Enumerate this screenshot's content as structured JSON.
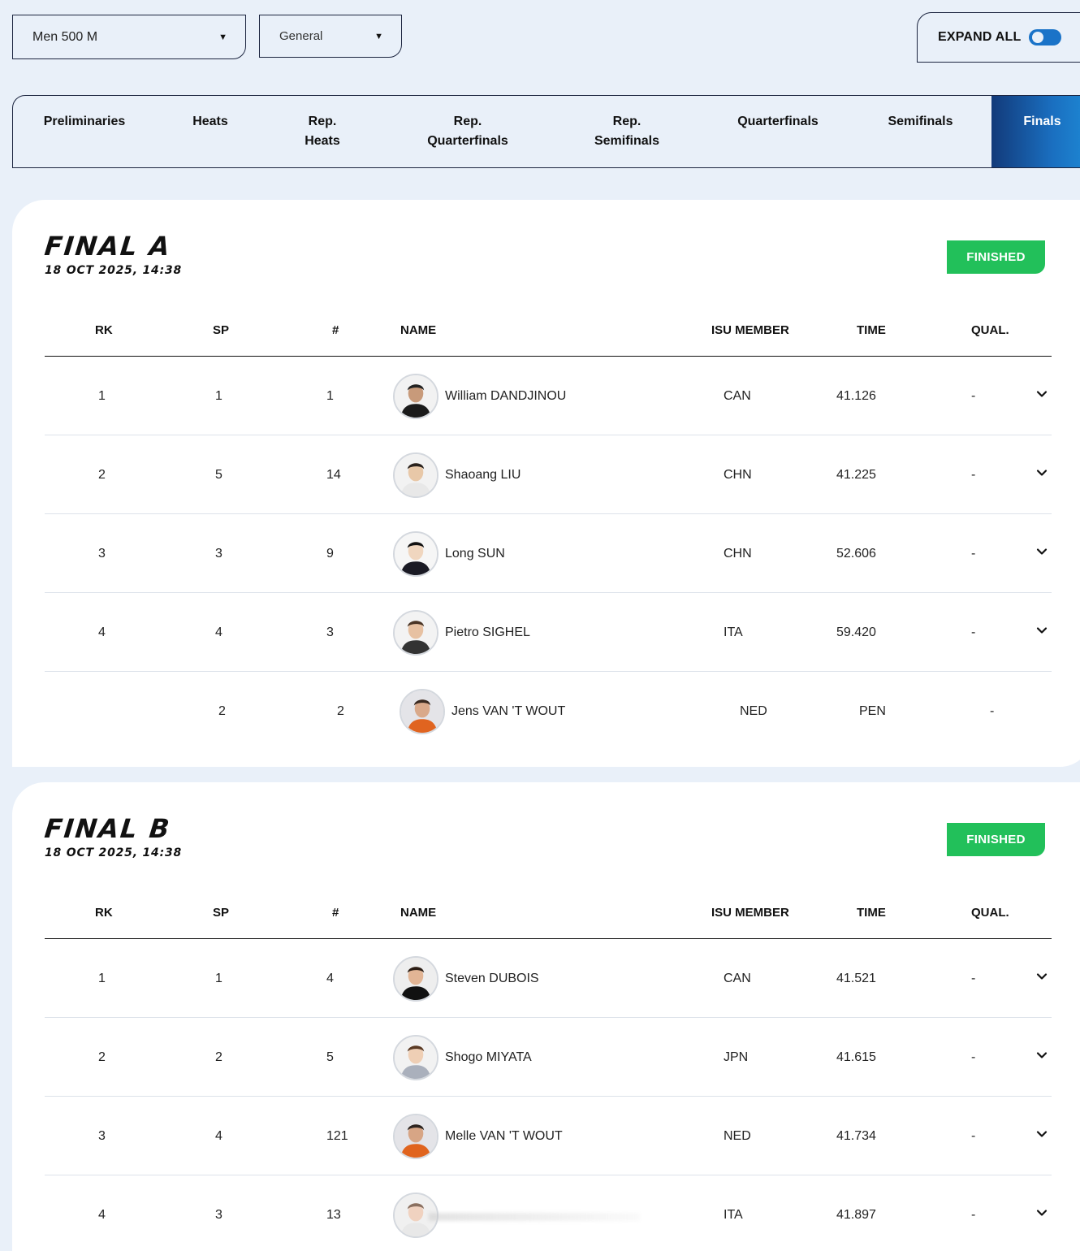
{
  "filters": {
    "distance": "Men 500 M",
    "category": "General",
    "expand_all_label": "EXPAND ALL",
    "expand_all_on": true
  },
  "tabs": [
    {
      "label": "Preliminaries",
      "active": false
    },
    {
      "label": "Heats",
      "active": false
    },
    {
      "label": "Rep.\nHeats",
      "active": false
    },
    {
      "label": "Rep.\nQuarterfinals",
      "active": false
    },
    {
      "label": "Rep.\nSemifinals",
      "active": false
    },
    {
      "label": "Quarterfinals",
      "active": false
    },
    {
      "label": "Semifinals",
      "active": false
    },
    {
      "label": "Finals",
      "active": true
    }
  ],
  "columns": {
    "rk": "RK",
    "sp": "SP",
    "num": "#",
    "name": "NAME",
    "member": "ISU MEMBER",
    "time": "TIME",
    "qual": "QUAL."
  },
  "colors": {
    "background": "#e9f0f9",
    "finished_badge": "#22c05a",
    "active_tab_start": "#123a7a",
    "active_tab_end": "#1e8ad6",
    "toggle": "#1a73c8"
  },
  "races": [
    {
      "title": "FINAL A",
      "date": "18 OCT 2025, 14:38",
      "status": "FINISHED",
      "rows": [
        {
          "rk": "1",
          "sp": "1",
          "num": "1",
          "name": "William DANDJINOU",
          "member": "CAN",
          "time": "41.126",
          "qual": "-",
          "expandable": true
        },
        {
          "rk": "2",
          "sp": "5",
          "num": "14",
          "name": "Shaoang LIU",
          "member": "CHN",
          "time": "41.225",
          "qual": "-",
          "expandable": true
        },
        {
          "rk": "3",
          "sp": "3",
          "num": "9",
          "name": "Long SUN",
          "member": "CHN",
          "time": "52.606",
          "qual": "-",
          "expandable": true
        },
        {
          "rk": "4",
          "sp": "4",
          "num": "3",
          "name": "Pietro SIGHEL",
          "member": "ITA",
          "time": "59.420",
          "qual": "-",
          "expandable": true
        },
        {
          "rk": "",
          "sp": "2",
          "num": "2",
          "name": "Jens VAN 'T WOUT",
          "member": "NED",
          "time": "PEN",
          "qual": "-",
          "expandable": false
        }
      ]
    },
    {
      "title": "FINAL B",
      "date": "18 OCT 2025, 14:38",
      "status": "FINISHED",
      "rows": [
        {
          "rk": "1",
          "sp": "1",
          "num": "4",
          "name": "Steven DUBOIS",
          "member": "CAN",
          "time": "41.521",
          "qual": "-",
          "expandable": true
        },
        {
          "rk": "2",
          "sp": "2",
          "num": "5",
          "name": "Shogo MIYATA",
          "member": "JPN",
          "time": "41.615",
          "qual": "-",
          "expandable": true
        },
        {
          "rk": "3",
          "sp": "4",
          "num": "121",
          "name": "Melle VAN 'T WOUT",
          "member": "NED",
          "time": "41.734",
          "qual": "-",
          "expandable": true
        },
        {
          "rk": "4",
          "sp": "3",
          "num": "13",
          "name": "",
          "member": "ITA",
          "time": "41.897",
          "qual": "-",
          "expandable": true
        }
      ]
    }
  ]
}
